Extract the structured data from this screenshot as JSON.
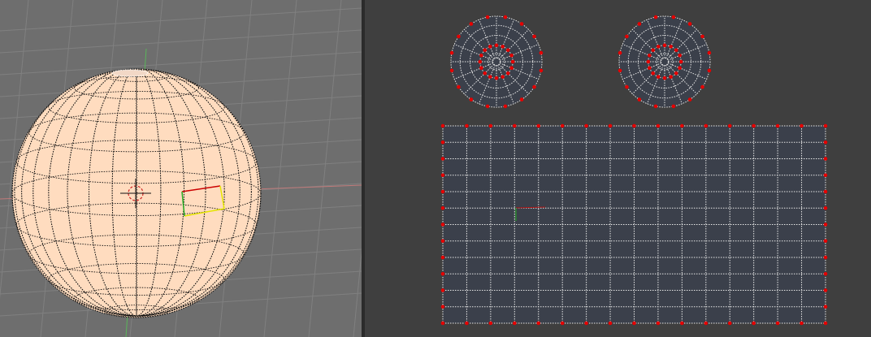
{
  "viewport_3d": {
    "background_color": "#6e6e6e",
    "grid_color": "#808080",
    "mesh_fill_color": "#ffdcbf",
    "wire_color": "#111111",
    "cursor_color": "#cc2222",
    "active_face_edge_colors": [
      "#cc0000",
      "#e6e600",
      "#22aa22"
    ],
    "icons": [
      "3d-cursor-icon"
    ]
  },
  "uv_editor": {
    "background_color": "#3f3f3f",
    "island_fill_color": "#3b404b",
    "edge_color": "#e6e6e6",
    "vertex_color": "#e60000",
    "grid_columns": 16,
    "grid_rows": 12,
    "circle_islands": 2
  }
}
